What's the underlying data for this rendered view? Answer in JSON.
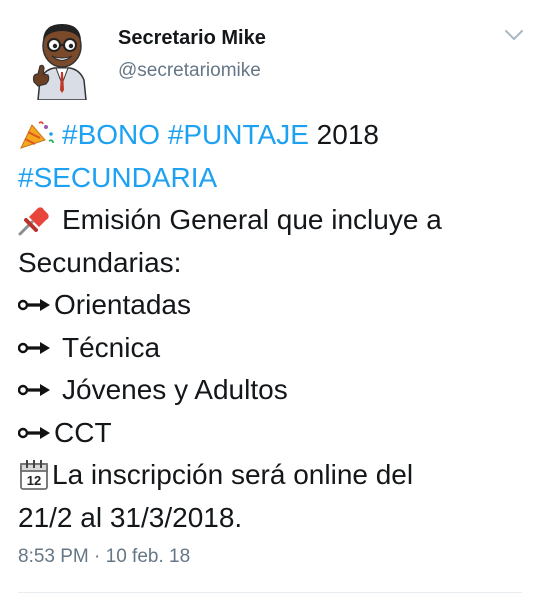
{
  "author": {
    "display_name": "Secretario Mike",
    "handle": "@secretariomike",
    "avatar_icon": "cartoon-man-thumbs-up-avatar"
  },
  "menu_icon": "chevron-down-icon",
  "colors": {
    "hashtag": "#1da1f2",
    "text": "#14171a",
    "muted": "#657786"
  },
  "tweet": {
    "line1": {
      "icon": "party-popper-icon",
      "tag1": "#BONO",
      "tag2": "#PUNTAJE",
      "text": "2018"
    },
    "line2": {
      "tag": "#SECUNDARIA"
    },
    "line3": {
      "icon": "pushpin-icon",
      "text": "Emisión General que incluye a"
    },
    "line4": {
      "text": "Secundarias:"
    },
    "line5": {
      "icon": "arrow-icon",
      "text": "Orientadas"
    },
    "line6": {
      "icon": "arrow-icon",
      "text": "Técnica"
    },
    "line7": {
      "icon": "arrow-icon",
      "text": "Jóvenes y Adultos"
    },
    "line8": {
      "icon": "arrow-icon",
      "text": "CCT"
    },
    "line9": {
      "icon": "calendar-icon",
      "calendar_number": "12",
      "text": "La inscripción será online del"
    },
    "line10": {
      "text": "21/2 al 31/3/2018."
    }
  },
  "timestamp": "8:53 PM · 10 feb. 18"
}
